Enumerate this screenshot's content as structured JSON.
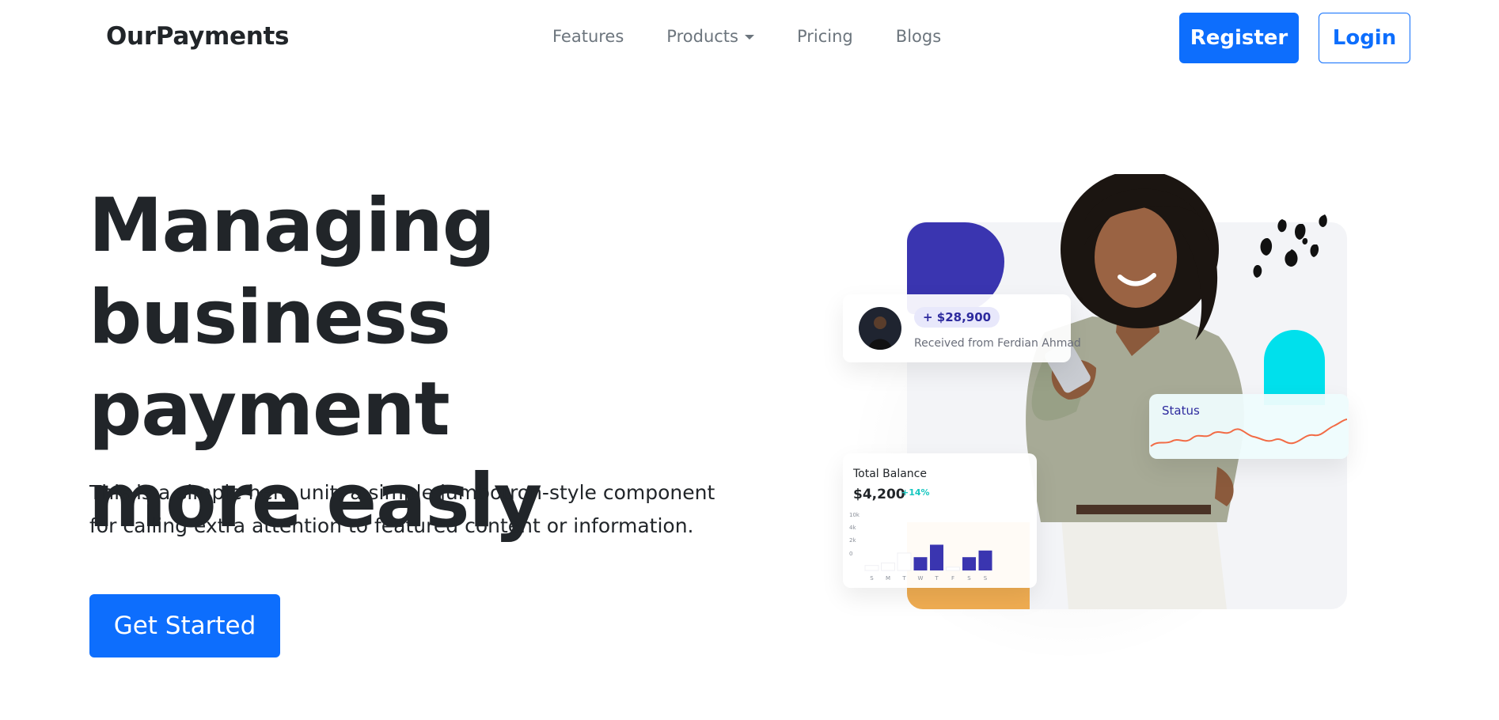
{
  "brand": "OurPayments",
  "nav": {
    "features": "Features",
    "products": "Products",
    "pricing": "Pricing",
    "blogs": "Blogs"
  },
  "auth": {
    "register": "Register",
    "login": "Login"
  },
  "hero": {
    "title_line1": "Managing",
    "title_line2": "business payment",
    "title_line3": "more easly",
    "lead_line1": "This is a simple hero unit, a simple jumbotron-style component",
    "lead_line2": "for calling extra attention to featured content or information.",
    "cta": "Get Started"
  },
  "illustration": {
    "received_amount": "+ $28,900",
    "received_from": "Received from Ferdian Ahmad",
    "status_label": "Status",
    "balance_label": "Total Balance",
    "balance_amount": "$4,200",
    "balance_change": "+14%"
  },
  "chart_data": {
    "type": "bar",
    "categories": [
      "S",
      "M",
      "T",
      "W",
      "T",
      "F",
      "S",
      "S"
    ],
    "series": [
      {
        "values": [
          1.2,
          1.8,
          4.2,
          3.2,
          6.2,
          0.8,
          3.2,
          4.8
        ]
      }
    ],
    "ylabels": [
      "10k",
      "4k",
      "2k",
      "0"
    ],
    "ylim": [
      0,
      10
    ],
    "colors": {
      "highlight": "#3a35b0",
      "muted": "#ffffff"
    },
    "highlighted": [
      false,
      false,
      false,
      true,
      true,
      false,
      true,
      true
    ]
  },
  "colors": {
    "primary": "#0d6efd",
    "text": "#212529",
    "muted_text": "#6c757d",
    "purple": "#3a35b0",
    "cyan": "#00e0ec",
    "orange": "#f0ad52",
    "status_line": "#f26b45"
  }
}
